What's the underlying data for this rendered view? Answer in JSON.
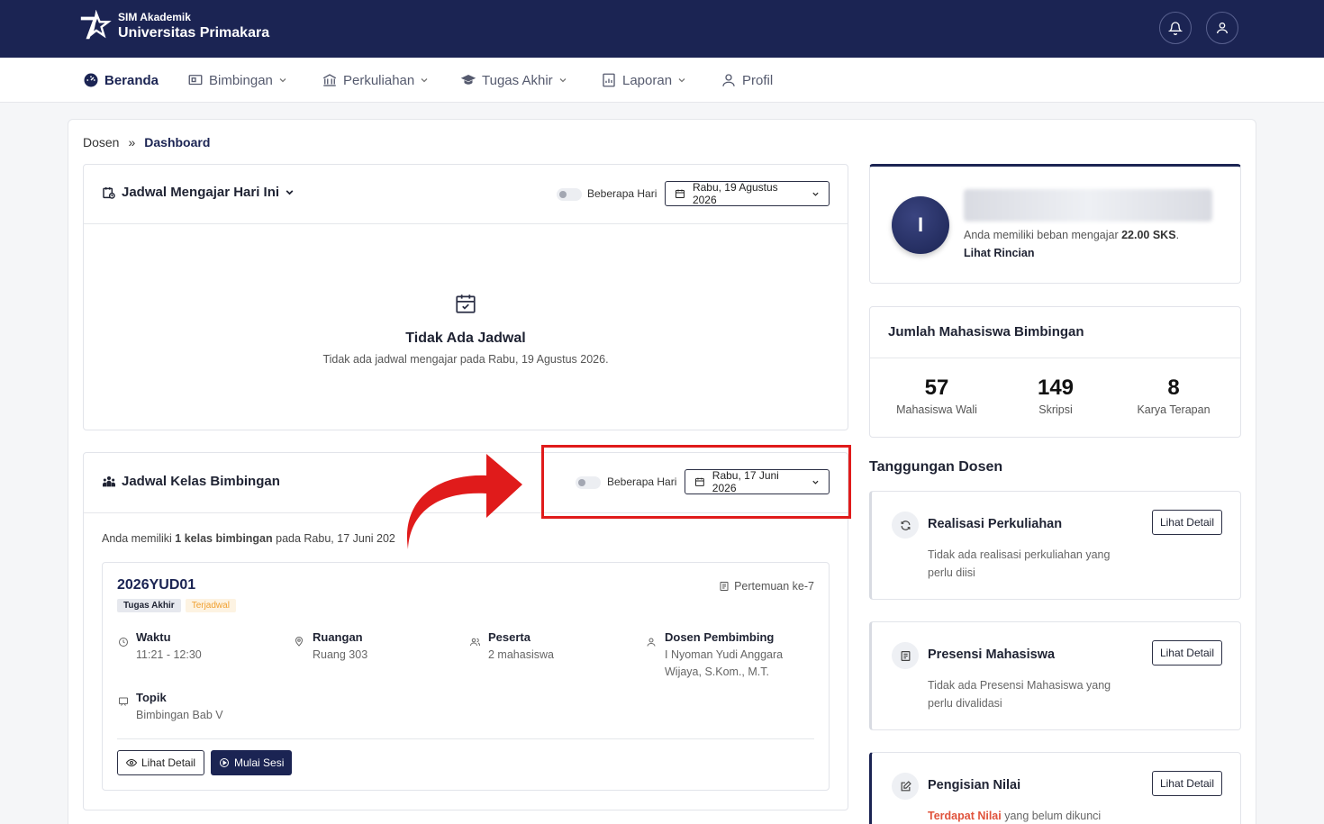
{
  "header": {
    "brand_sub": "SIM Akademik",
    "brand_main": "Universitas Primakara"
  },
  "nav": {
    "items": [
      {
        "label": "Beranda",
        "icon": "dashboard-icon"
      },
      {
        "label": "Bimbingan",
        "icon": "board-icon"
      },
      {
        "label": "Perkuliahan",
        "icon": "building-icon"
      },
      {
        "label": "Tugas Akhir",
        "icon": "graduation-cap-icon"
      },
      {
        "label": "Laporan",
        "icon": "report-icon"
      },
      {
        "label": "Profil",
        "icon": "user-icon"
      }
    ]
  },
  "breadcrumb": {
    "root": "Dosen",
    "sep": "»",
    "current": "Dashboard"
  },
  "jadwal_mengajar": {
    "title": "Jadwal Mengajar Hari Ini",
    "toggle_label": "Beberapa Hari",
    "date": "Rabu, 19 Agustus 2026",
    "empty_title": "Tidak Ada Jadwal",
    "empty_desc": "Tidak ada jadwal mengajar pada Rabu, 19 Agustus 2026."
  },
  "jadwal_bimbingan": {
    "title": "Jadwal Kelas Bimbingan",
    "toggle_label": "Beberapa Hari",
    "date": "Rabu, 17 Juni 2026",
    "summary_pre": "Anda memiliki ",
    "summary_bold": "1 kelas bimbingan",
    "summary_post": " pada Rabu, 17 Juni 202",
    "class": {
      "code": "2026YUD01",
      "tag_type": "Tugas Akhir",
      "tag_status": "Terjadwal",
      "meeting": "Pertemuan ke-7",
      "waktu_label": "Waktu",
      "waktu_value": "11:21 - 12:30",
      "ruangan_label": "Ruangan",
      "ruangan_value": "Ruang 303",
      "peserta_label": "Peserta",
      "peserta_value": "2 mahasiswa",
      "dosen_label": "Dosen Pembimbing",
      "dosen_value": "I Nyoman Yudi Anggara Wijaya, S.Kom., M.T.",
      "topik_label": "Topik",
      "topik_value": "Bimbingan Bab V",
      "detail_btn": "Lihat Detail",
      "start_btn": "Mulai Sesi"
    }
  },
  "profile": {
    "initial": "I",
    "load_pre": "Anda memiliki beban mengajar ",
    "load_value": "22.00 SKS",
    "load_post": ".",
    "link": "Lihat Rincian"
  },
  "jumlah": {
    "title": "Jumlah Mahasiswa Bimbingan",
    "stats": [
      {
        "value": "57",
        "label": "Mahasiswa Wali"
      },
      {
        "value": "149",
        "label": "Skripsi"
      },
      {
        "value": "8",
        "label": "Karya Terapan"
      }
    ]
  },
  "tanggungan": {
    "title": "Tanggungan Dosen",
    "items": [
      {
        "title": "Realisasi Perkuliahan",
        "desc": "Tidak ada realisasi perkuliahan yang perlu diisi",
        "btn": "Lihat Detail",
        "icon": "refresh-icon"
      },
      {
        "title": "Presensi Mahasiswa",
        "desc": "Tidak ada Presensi Mahasiswa yang perlu divalidasi",
        "btn": "Lihat Detail",
        "icon": "list-icon"
      },
      {
        "title": "Pengisian Nilai",
        "desc_highlight": "Terdapat Nilai",
        "desc_rest": " yang belum dikunci",
        "btn": "Lihat Detail",
        "icon": "edit-icon"
      }
    ]
  },
  "colors": {
    "navy": "#1b2453",
    "annotation_red": "#e01b1b",
    "warning_orange": "#f0a030",
    "danger_text": "#e0533c"
  }
}
